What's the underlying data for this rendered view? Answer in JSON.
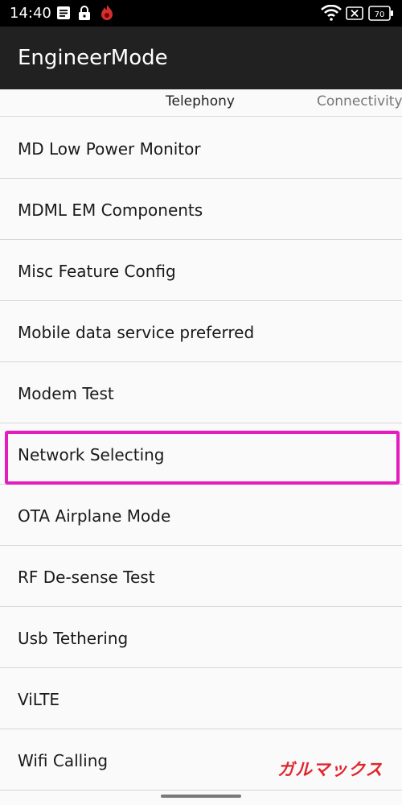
{
  "status_bar": {
    "time": "14:40",
    "battery": "70",
    "icons": [
      "message-icon",
      "lock-icon",
      "app-flame-icon",
      "wifi-icon",
      "no-sim-icon",
      "battery-icon"
    ]
  },
  "app_bar": {
    "title": "EngineerMode"
  },
  "tabs": [
    {
      "label": "Telephony",
      "selected": true
    },
    {
      "label": "Connectivity",
      "selected": false
    }
  ],
  "menu": {
    "items": [
      {
        "label": "MD Low Power Monitor"
      },
      {
        "label": "MDML EM Components"
      },
      {
        "label": "Misc Feature Config"
      },
      {
        "label": "Mobile data service preferred"
      },
      {
        "label": "Modem Test"
      },
      {
        "label": "Network Selecting",
        "highlighted": true
      },
      {
        "label": "OTA Airplane Mode"
      },
      {
        "label": "RF De-sense Test"
      },
      {
        "label": "Usb Tethering"
      },
      {
        "label": "ViLTE"
      },
      {
        "label": "Wifi Calling"
      }
    ]
  },
  "watermark": "ガルマックス",
  "colors": {
    "highlight": "#e41bbd",
    "app_bar": "#212121",
    "watermark": "#e0262e"
  }
}
